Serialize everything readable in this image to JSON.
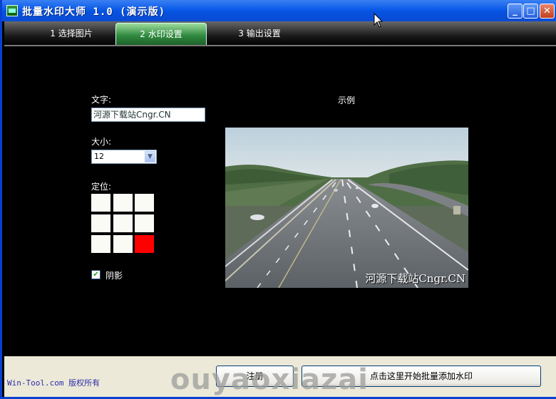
{
  "window": {
    "title": "批量水印大师 1.0 (演示版)",
    "minimize": "_",
    "maximize": "□",
    "close": "✕"
  },
  "tabs": [
    {
      "label": "1 选择图片",
      "active": false
    },
    {
      "label": "2 水印设置",
      "active": true
    },
    {
      "label": "3 输出设置",
      "active": false
    }
  ],
  "form": {
    "text_label": "文字:",
    "text_value": "河源下载站Cngr.CN",
    "size_label": "大小:",
    "size_value": "12",
    "position_label": "定位:",
    "position_selected": "bottom-right",
    "shadow_label": "阴影",
    "shadow_checked": true
  },
  "preview": {
    "label": "示例",
    "watermark": "河源下载站Cngr.CN"
  },
  "footer": {
    "copyright": "Win-Tool.com 版权所有",
    "register": "注册",
    "start": "点击这里开始批量添加水印"
  },
  "overlay_watermark": "ouyaoxiazai",
  "colors": {
    "accent_tab": "#2f8a3f",
    "selected_cell": "#ff0000",
    "titlebar": "#0a5ae8"
  }
}
